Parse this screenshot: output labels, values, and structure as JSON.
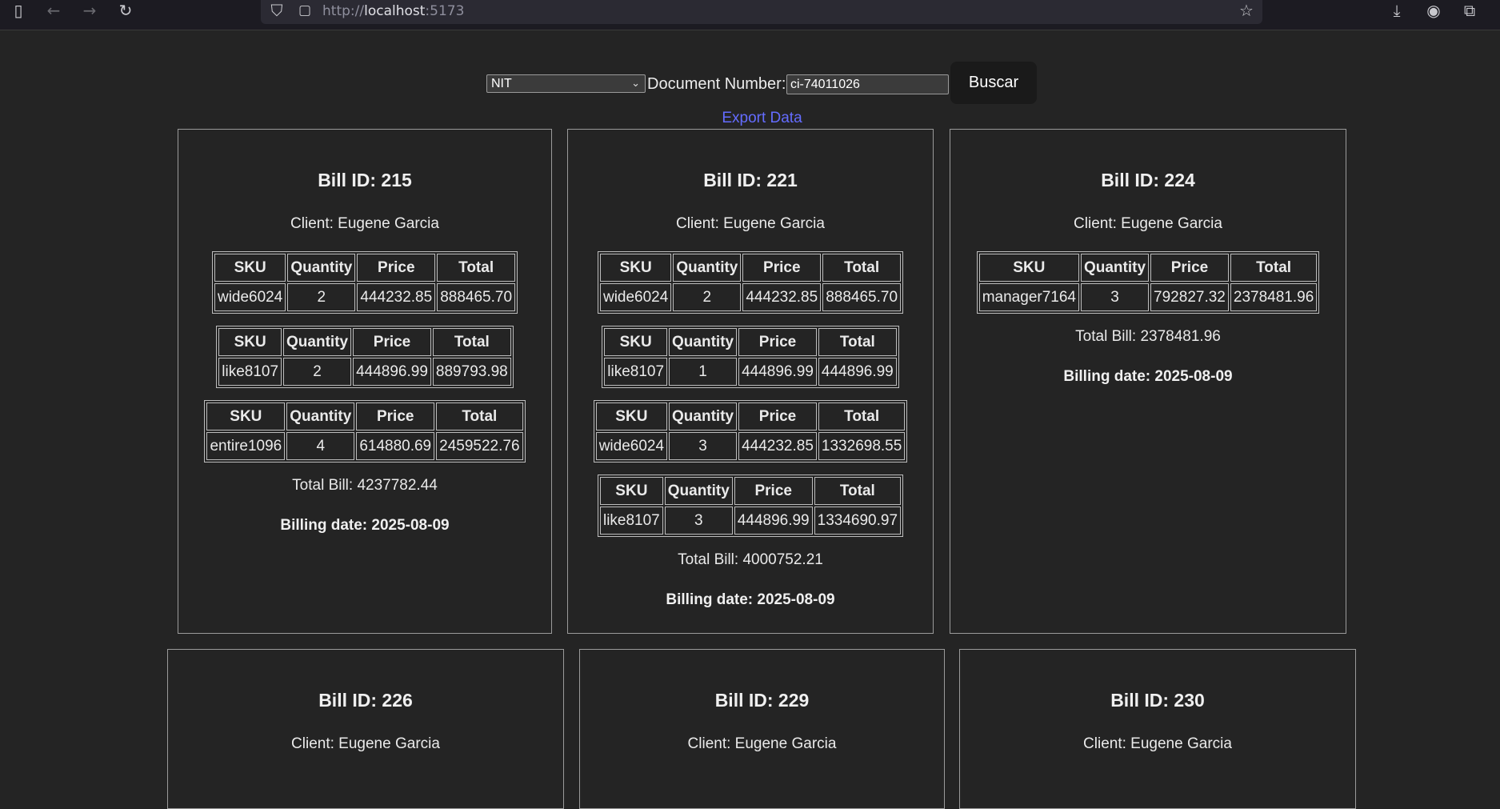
{
  "browser": {
    "url_prefix": "http://",
    "url_host": "localhost",
    "url_port": ":5173"
  },
  "search": {
    "doc_type": "NIT",
    "label": "Document Number:",
    "value": "ci-74011026",
    "button": "Buscar"
  },
  "export_label": "Export Data",
  "headers": [
    "SKU",
    "Quantity",
    "Price",
    "Total"
  ],
  "bills": [
    {
      "title": "Bill ID: 215",
      "client": "Client: Eugene Garcia",
      "items": [
        {
          "sku": "wide6024",
          "qty": "2",
          "price": "444232.85",
          "total": "888465.70"
        },
        {
          "sku": "like8107",
          "qty": "2",
          "price": "444896.99",
          "total": "889793.98"
        },
        {
          "sku": "entire1096",
          "qty": "4",
          "price": "614880.69",
          "total": "2459522.76"
        }
      ],
      "total_bill": "Total Bill: 4237782.44",
      "billing_date": "Billing date: 2025-08-09"
    },
    {
      "title": "Bill ID: 221",
      "client": "Client: Eugene Garcia",
      "items": [
        {
          "sku": "wide6024",
          "qty": "2",
          "price": "444232.85",
          "total": "888465.70"
        },
        {
          "sku": "like8107",
          "qty": "1",
          "price": "444896.99",
          "total": "444896.99"
        },
        {
          "sku": "wide6024",
          "qty": "3",
          "price": "444232.85",
          "total": "1332698.55"
        },
        {
          "sku": "like8107",
          "qty": "3",
          "price": "444896.99",
          "total": "1334690.97"
        }
      ],
      "total_bill": "Total Bill: 4000752.21",
      "billing_date": "Billing date: 2025-08-09"
    },
    {
      "title": "Bill ID: 224",
      "client": "Client: Eugene Garcia",
      "items": [
        {
          "sku": "manager7164",
          "qty": "3",
          "price": "792827.32",
          "total": "2378481.96"
        }
      ],
      "total_bill": "Total Bill: 2378481.96",
      "billing_date": "Billing date: 2025-08-09"
    },
    {
      "title": "Bill ID: 226",
      "client": "Client: Eugene Garcia"
    },
    {
      "title": "Bill ID: 229",
      "client": "Client: Eugene Garcia"
    },
    {
      "title": "Bill ID: 230",
      "client": "Client: Eugene Garcia"
    }
  ]
}
